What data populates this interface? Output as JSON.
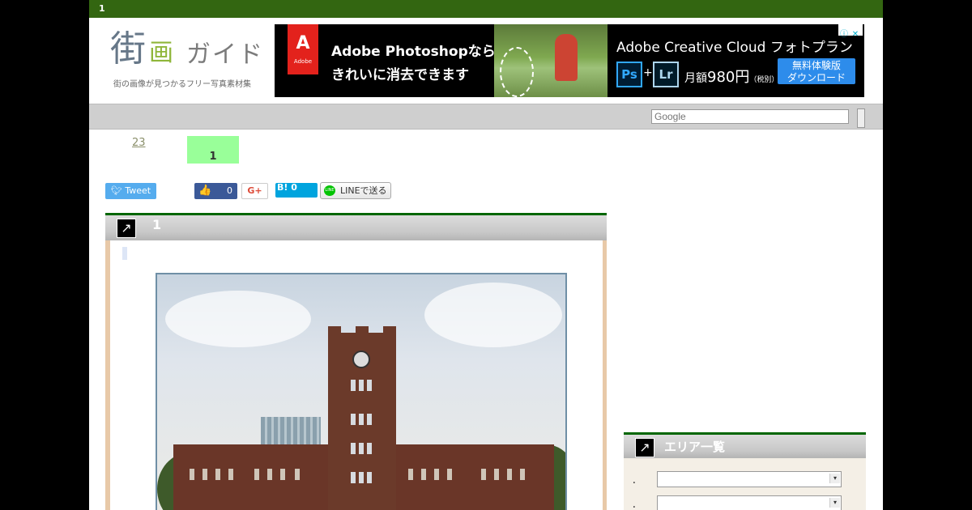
{
  "topbar": {
    "title": "1"
  },
  "logo": {
    "kanji1": "街",
    "kanji2": "画",
    "kana": "ガイド",
    "tagline": "街の画像が見つかるフリー写真素材集"
  },
  "ad": {
    "brand": "Adobe",
    "line1": "Adobe Photoshopなら",
    "line2": "きれいに消去できます",
    "cc_title": "Adobe Creative Cloud フォトプラン",
    "ps": "Ps",
    "plus": "+",
    "lr": "Lr",
    "price_prefix": "月額",
    "price_value": "980円",
    "price_note": "（税別）",
    "cta_line1": "無料体験版",
    "cta_line2": "ダウンロード",
    "info": "ⓘ",
    "close": "✕"
  },
  "search": {
    "placeholder": "Google"
  },
  "breadcrumb": {
    "count": "23",
    "current": "1"
  },
  "social": {
    "tweet": "Tweet",
    "fb_icon": "👍",
    "fb_count": "0",
    "gplus": "G+",
    "hatena": "B! 0",
    "line_icon": "LINE",
    "line": "LINEで送る"
  },
  "article": {
    "icon": "↗",
    "title": "1"
  },
  "sidebar": {
    "icon": "↗",
    "title": "エリア一覧",
    "rows": [
      {
        "label": "．",
        "value": ""
      },
      {
        "label": "．",
        "value": ""
      }
    ],
    "caret": "▾"
  }
}
